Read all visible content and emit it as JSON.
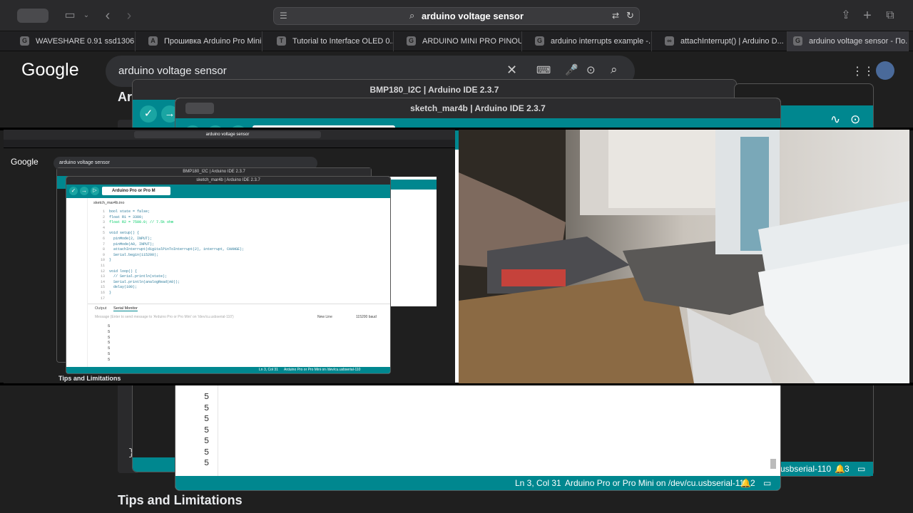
{
  "browser": {
    "address_text": "arduino voltage sensor",
    "tabs": [
      {
        "label": "WAVESHARE 0.91 ssd1306 -...",
        "fav": "G"
      },
      {
        "label": "Прошивка Arduino Pro Mini...",
        "fav": "A"
      },
      {
        "label": "Tutorial to Interface OLED 0...",
        "fav": "T"
      },
      {
        "label": "ARDUINO MINI PRO PINOUT...",
        "fav": "G"
      },
      {
        "label": "arduino interrupts example -...",
        "fav": "G"
      },
      {
        "label": "attachInterrupt() | Arduino D...",
        "fav": "∞"
      },
      {
        "label": "arduino voltage sensor - По...",
        "fav": "G"
      }
    ]
  },
  "google": {
    "logo": "Google",
    "query": "arduino voltage sensor",
    "heading": "Tips and Limitations",
    "partial_heading": "Ar"
  },
  "ide_back": {
    "title": "BMP180_I2C | Arduino IDE 2.3.7"
  },
  "ide_front": {
    "title": "sketch_mar4b | Arduino IDE 2.3.7",
    "board": "Arduino Pro or Pro M",
    "board_full": "Arduino Pro or Pro Mini",
    "filename": "sketch_mar4b.ino",
    "serial_values": [
      "5",
      "5",
      "5",
      "5",
      "5",
      "5",
      "5"
    ],
    "status_pos": "Ln 3, Col 31",
    "status_board": "Arduino Pro or Pro Mini on /dev/cu.usbserial-110",
    "status_count": "2",
    "back_status": "usbserial-110",
    "back_count": "3"
  },
  "mini": {
    "code_lines": [
      {
        "n": "1",
        "t": "bool state = false;"
      },
      {
        "n": "2",
        "t": "float R1 = 3300;"
      },
      {
        "n": "3",
        "t": "float R2 = 7500.0; // 7.5k ohm"
      },
      {
        "n": "4",
        "t": ""
      },
      {
        "n": "5",
        "t": "void setup() {"
      },
      {
        "n": "6",
        "t": "  pinMode(2, INPUT);"
      },
      {
        "n": "7",
        "t": "  pinMode(A0, INPUT);"
      },
      {
        "n": "8",
        "t": "  attachInterrupt(digitalPinToInterrupt(2), interrupt, CHANGE);"
      },
      {
        "n": "9",
        "t": "  Serial.begin(115200);"
      },
      {
        "n": "10",
        "t": "}"
      },
      {
        "n": "11",
        "t": ""
      },
      {
        "n": "12",
        "t": "void loop() {"
      },
      {
        "n": "13",
        "t": "  // Serial.println(state);"
      },
      {
        "n": "14",
        "t": "  Serial.println(analogRead(A0));"
      },
      {
        "n": "15",
        "t": "  delay(100);"
      },
      {
        "n": "16",
        "t": "}"
      },
      {
        "n": "17",
        "t": ""
      }
    ],
    "output_tab": "Output",
    "serial_tab": "Serial Monitor",
    "message_placeholder": "Message (Enter to send message to 'Arduino Pro or Pro Mini' on '/dev/cu.usbserial-110')",
    "line_ending": "New Line",
    "baud": "115200 baud",
    "mini_serial": [
      "5",
      "5",
      "5",
      "5",
      "5",
      "5",
      "5"
    ],
    "status_pos": "Ln 3, Col 31",
    "status_board": "Arduino Pro or Pro Mini on /dev/cu.usbserial-110",
    "heading": "Tips and Limitations"
  }
}
